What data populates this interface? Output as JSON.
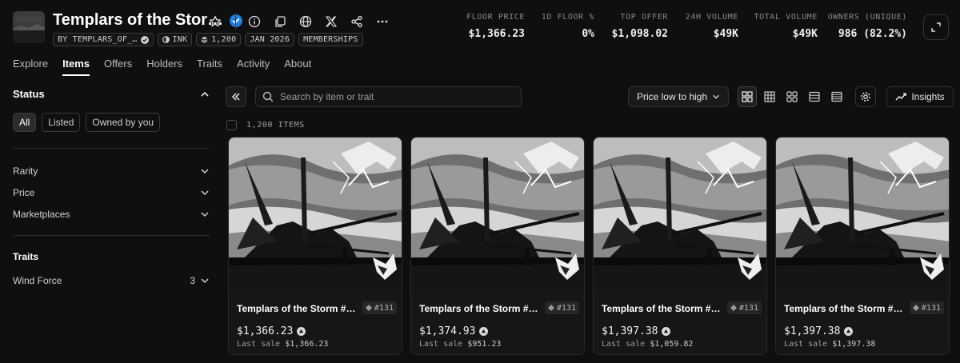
{
  "collection": {
    "title": "Templars of the Stor…",
    "tags": {
      "creator": "BY TEMPLARS_OF_…",
      "chain": "INK",
      "supply": "1,200",
      "date": "JAN 2026",
      "category": "MEMBERSHIPS"
    }
  },
  "stats": [
    {
      "label": "FLOOR PRICE",
      "value": "$1,366.23"
    },
    {
      "label": "1D FLOOR %",
      "value": "0%"
    },
    {
      "label": "TOP OFFER",
      "value": "$1,098.02"
    },
    {
      "label": "24H VOLUME",
      "value": "$49K"
    },
    {
      "label": "TOTAL VOLUME",
      "value": "$49K"
    },
    {
      "label": "OWNERS (UNIQUE)",
      "value": "986 (82.2%)"
    }
  ],
  "tabs": [
    "Explore",
    "Items",
    "Offers",
    "Holders",
    "Traits",
    "Activity",
    "About"
  ],
  "sidebar": {
    "status_title": "Status",
    "status_chips": [
      "All",
      "Listed",
      "Owned by you"
    ],
    "filters": [
      "Rarity",
      "Price",
      "Marketplaces"
    ],
    "traits_title": "Traits",
    "trait": {
      "name": "Wind Force",
      "count": "3"
    }
  },
  "toolbar": {
    "search_placeholder": "Search by item or trait",
    "sort_label": "Price low to high",
    "insights_label": "Insights"
  },
  "items_count": "1,200 ITEMS",
  "items": [
    {
      "name": "Templars of the Storm #…",
      "rank": "#131",
      "price": "$1,366.23",
      "last_sale_label": "Last sale",
      "last_sale": "$1,366.23"
    },
    {
      "name": "Templars of the Storm #…",
      "rank": "#131",
      "price": "$1,374.93",
      "last_sale_label": "Last sale",
      "last_sale": "$951.23"
    },
    {
      "name": "Templars of the Storm #…",
      "rank": "#131",
      "price": "$1,397.38",
      "last_sale_label": "Last sale",
      "last_sale": "$1,059.82"
    },
    {
      "name": "Templars of the Storm #…",
      "rank": "#131",
      "price": "$1,397.38",
      "last_sale_label": "Last sale",
      "last_sale": "$1,397.38"
    }
  ],
  "colors": {
    "background": "#0f0f10",
    "verified": "#2081e2",
    "text": "#ffffff"
  }
}
